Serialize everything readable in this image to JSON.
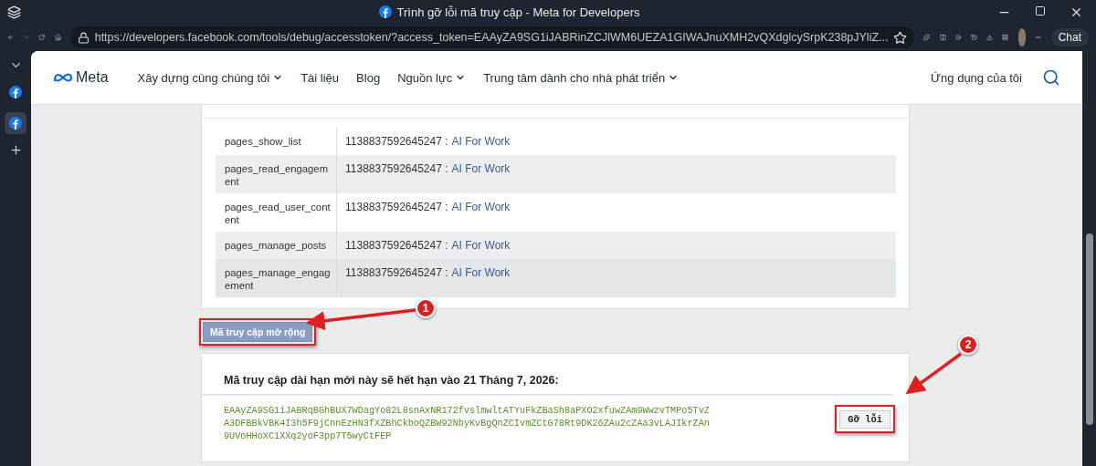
{
  "window": {
    "title": "Trình gỡ lỗi mã truy cập - Meta for Developers",
    "url": "https://developers.facebook.com/tools/debug/accesstoken/?access_token=EAAyZA9SG1iJABRinZCJlWM6UEZA1GIWAJnuXMH2vQXdglcySrpK238pJYliZ...",
    "chat_label": "Chat"
  },
  "nav": {
    "logo": "Meta",
    "items": [
      {
        "label": "Xây dựng cùng chúng tôi",
        "has_menu": true
      },
      {
        "label": "Tài liệu",
        "has_menu": false
      },
      {
        "label": "Blog",
        "has_menu": false
      },
      {
        "label": "Nguồn lực",
        "has_menu": true
      },
      {
        "label": "Trung tâm dành cho nhà phát triển",
        "has_menu": true
      }
    ],
    "my_apps": "Ứng dụng của tôi"
  },
  "permissions": [
    {
      "name": "pages_show_list",
      "id": "1138837592645247 :",
      "page": "AI For Work"
    },
    {
      "name": "pages_read_engagement",
      "id": "1138837592645247 :",
      "page": "AI For Work"
    },
    {
      "name": "pages_read_user_content",
      "id": "1138837592645247 :",
      "page": "AI For Work"
    },
    {
      "name": "pages_manage_posts",
      "id": "1138837592645247 :",
      "page": "AI For Work"
    },
    {
      "name": "pages_manage_engagement",
      "id": "1138837592645247 :",
      "page": "AI For Work"
    }
  ],
  "extend_button": "Mã truy cập mở rộng",
  "long_token": {
    "heading": "Mã truy cập dài hạn mới này sẽ hết hạn vào 21 Tháng 7, 2026:",
    "lines": [
      "EAAyZA9SG1iJABRqBGhBUX7WDagYo82L8snAxNR172fvslmwltATYuFkZBaSh8aPXO2xfuwZAm9WwzvTMPo5TvZ",
      "A3DFBBkVBK4I3h5F9jCnnEzHN3fXZBhCkboQZBW92NbyKvBgQnZCIvmZCtG78Rt9DK26ZAu2cZAa3vLAJIkrZAn",
      "9UVoHHoXC1XXq2yoF3pp7T5wyCtFEP"
    ],
    "debug_button": "Gỡ lỗi"
  },
  "annotations": [
    {
      "label": "1"
    },
    {
      "label": "2"
    }
  ]
}
